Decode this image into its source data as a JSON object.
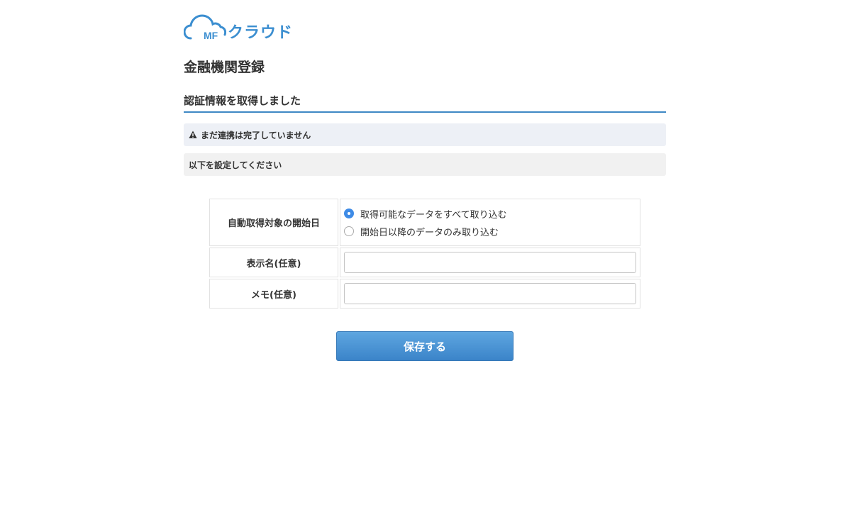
{
  "logo": {
    "mark": "MF",
    "text": "クラウド",
    "brand_color": "#3b8ed0"
  },
  "page_title": "金融機関登録",
  "section_heading": "認証情報を取得しました",
  "alert": {
    "icon": "warning-icon",
    "text": "まだ連携は完了していません"
  },
  "note": "以下を設定してください",
  "form": {
    "start_date": {
      "label": "自動取得対象の開始日",
      "options": [
        {
          "label": "取得可能なデータをすべて取り込む",
          "checked": true
        },
        {
          "label": "開始日以降のデータのみ取り込む",
          "checked": false
        }
      ]
    },
    "display_name": {
      "label": "表示名(任意)",
      "value": ""
    },
    "memo": {
      "label": "メモ(任意)",
      "value": ""
    }
  },
  "save_button": "保存する",
  "colors": {
    "accent": "#3e88c4",
    "radio_checked": "#3e8be6",
    "alert_bg": "#edf0f6",
    "note_bg": "#f1f1f1"
  }
}
